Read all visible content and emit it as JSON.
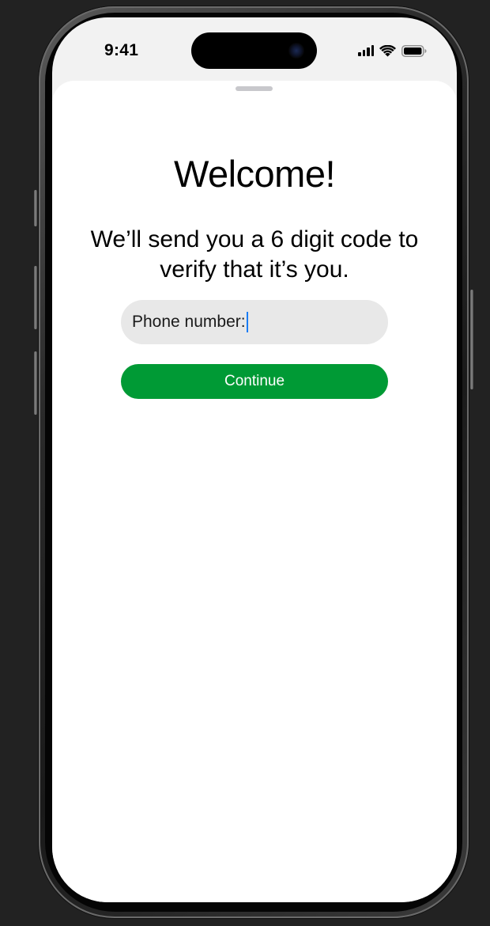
{
  "status_bar": {
    "time": "9:41",
    "icons": [
      "cellular-signal-icon",
      "wifi-icon",
      "battery-icon"
    ]
  },
  "sheet": {
    "title": "Welcome!",
    "subtitle": "We’ll send you a 6 digit code to verify that it’s you.",
    "phone_field": {
      "label": "Phone number:",
      "value": ""
    },
    "continue_label": "Continue"
  },
  "colors": {
    "accent_green": "#009a35",
    "caret_blue": "#1a7cf5",
    "input_background": "#e8e8e8",
    "backdrop": "#222222"
  }
}
